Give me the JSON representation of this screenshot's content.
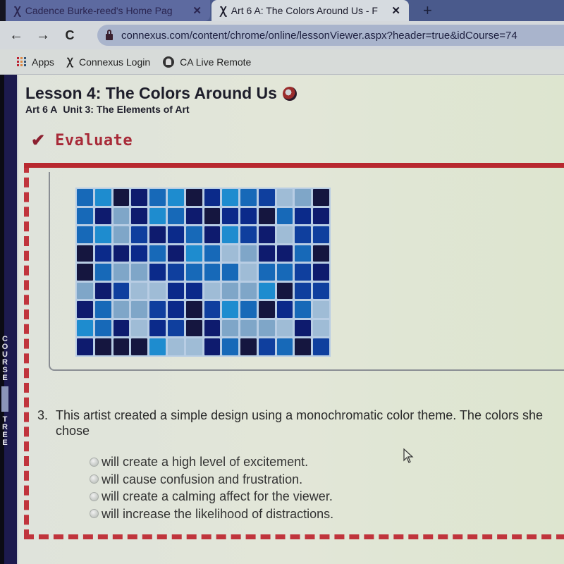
{
  "browser": {
    "tabs": [
      {
        "title": "Cadence Burke-reed's Home Pag",
        "logo": "connexus-logo",
        "active": false
      },
      {
        "title": "Art 6 A: The Colors Around Us - F",
        "logo": "connexus-logo",
        "active": true
      }
    ],
    "tab_logo_glyph": "Ꭓ",
    "close_glyph": "✕",
    "new_tab_glyph": "+",
    "nav": {
      "back": "←",
      "forward": "→",
      "reload": "C"
    },
    "url": "connexus.com/content/chrome/online/lessonViewer.aspx?header=true&idCourse=74",
    "bookmarks": [
      {
        "label": "Apps",
        "icon": "apps-grid-icon"
      },
      {
        "label": "Connexus Login",
        "icon": "connexus-logo-icon"
      },
      {
        "label": "CA Live Remote",
        "icon": "ca-live-icon"
      }
    ]
  },
  "sidebar": {
    "course_tab_letters": [
      "C",
      "O",
      "U",
      "R",
      "S",
      "E"
    ],
    "tree_tab_letters": [
      "T",
      "R",
      "E",
      "E"
    ]
  },
  "lesson": {
    "title": "Lesson 4: The Colors Around Us",
    "course": "Art 6 A",
    "unit": "Unit 3: The Elements of Art",
    "section_label": "Evaluate",
    "section_icon": "checkmark-icon"
  },
  "artwork": {
    "description": "Monochromatic blue glass tile mosaic",
    "columns": 14,
    "rows": 9,
    "palette": [
      "#15163f",
      "#0e1b6e",
      "#0f3f9e",
      "#1769b8",
      "#1e8ccf",
      "#7fa6c8",
      "#9fbcd6",
      "#0b2a8a"
    ]
  },
  "question": {
    "number": "3.",
    "text": "This artist created a simple design using a monochromatic color theme. The colors she chose",
    "options": [
      {
        "label": "will create a high level of excitement.",
        "selected": false
      },
      {
        "label": "will cause confusion and frustration.",
        "selected": false
      },
      {
        "label": "will create a calming affect for the viewer.",
        "selected": false
      },
      {
        "label": "will increase the likelihood of distractions.",
        "selected": false
      }
    ]
  },
  "colors": {
    "accent_red": "#b8282f",
    "sidebar_navy": "#1c1a4e",
    "tab_strip": "#4a5a8c"
  }
}
